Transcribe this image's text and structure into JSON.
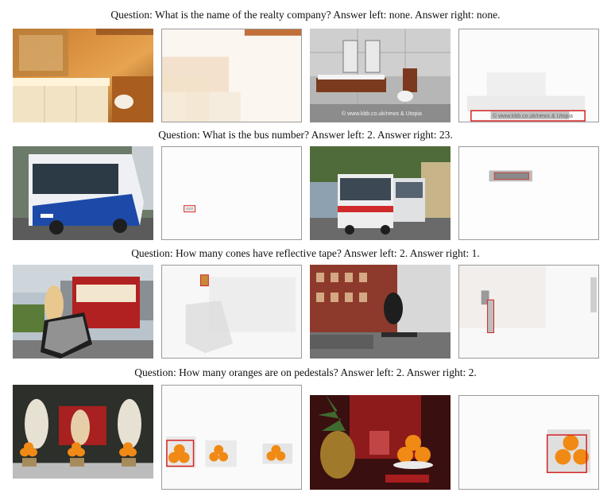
{
  "rows": [
    {
      "question": "Question: What is the name of the realty company? Answer left: none. Answer right: none.",
      "left_watermark": "",
      "right_watermark": "© www.kbb.co.uk/news & Utopia"
    },
    {
      "question": "Question: What is the bus number? Answer left: 2. Answer right: 23.",
      "left_watermark": "",
      "right_watermark": ""
    },
    {
      "question": "Question: How many cones have reflective tape? Answer left: 2. Answer right: 1.",
      "left_watermark": "",
      "right_watermark": ""
    },
    {
      "question": "Question: How many oranges are on pedestals? Answer left: 2. Answer right: 2.",
      "left_watermark": "",
      "right_watermark": ""
    }
  ],
  "colors": {
    "highlight_box": "#d42020",
    "tile_border": "#9a9a9a",
    "orange": "#f08a14"
  }
}
